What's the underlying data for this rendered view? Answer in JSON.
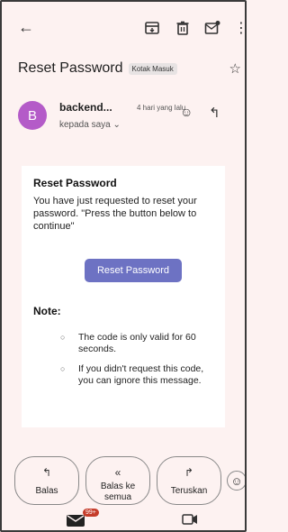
{
  "toolbar": {
    "back_icon": "arrow-left-icon",
    "archive_icon": "archive-icon",
    "trash_icon": "trash-icon",
    "mark_unread_icon": "mail-unread-icon",
    "more_icon": "more-vert-icon"
  },
  "subject": {
    "title": "Reset Password",
    "label": "Kotak Masuk"
  },
  "sender": {
    "avatar_letter": "B",
    "name": "backend...",
    "time": "4 hari yang lalu",
    "to": "kepada saya ⌄"
  },
  "email": {
    "heading": "Reset Password",
    "body": "You have just requested to reset your password. \"Press the button below to continue\"",
    "button_label": "Reset Password",
    "note_title": "Note:",
    "notes": [
      "The code is only valid for 60 seconds.",
      "If you didn't request this code, you can ignore this message."
    ]
  },
  "actions": {
    "reply": "Balas",
    "reply_all": "Balas ke semua",
    "forward": "Teruskan"
  },
  "bottom_nav": {
    "mail_badge": "99+"
  },
  "colors": {
    "background": "#fdf2f1",
    "avatar": "#b45bc8",
    "button": "#6d72c3",
    "badge": "#c53c2a"
  }
}
